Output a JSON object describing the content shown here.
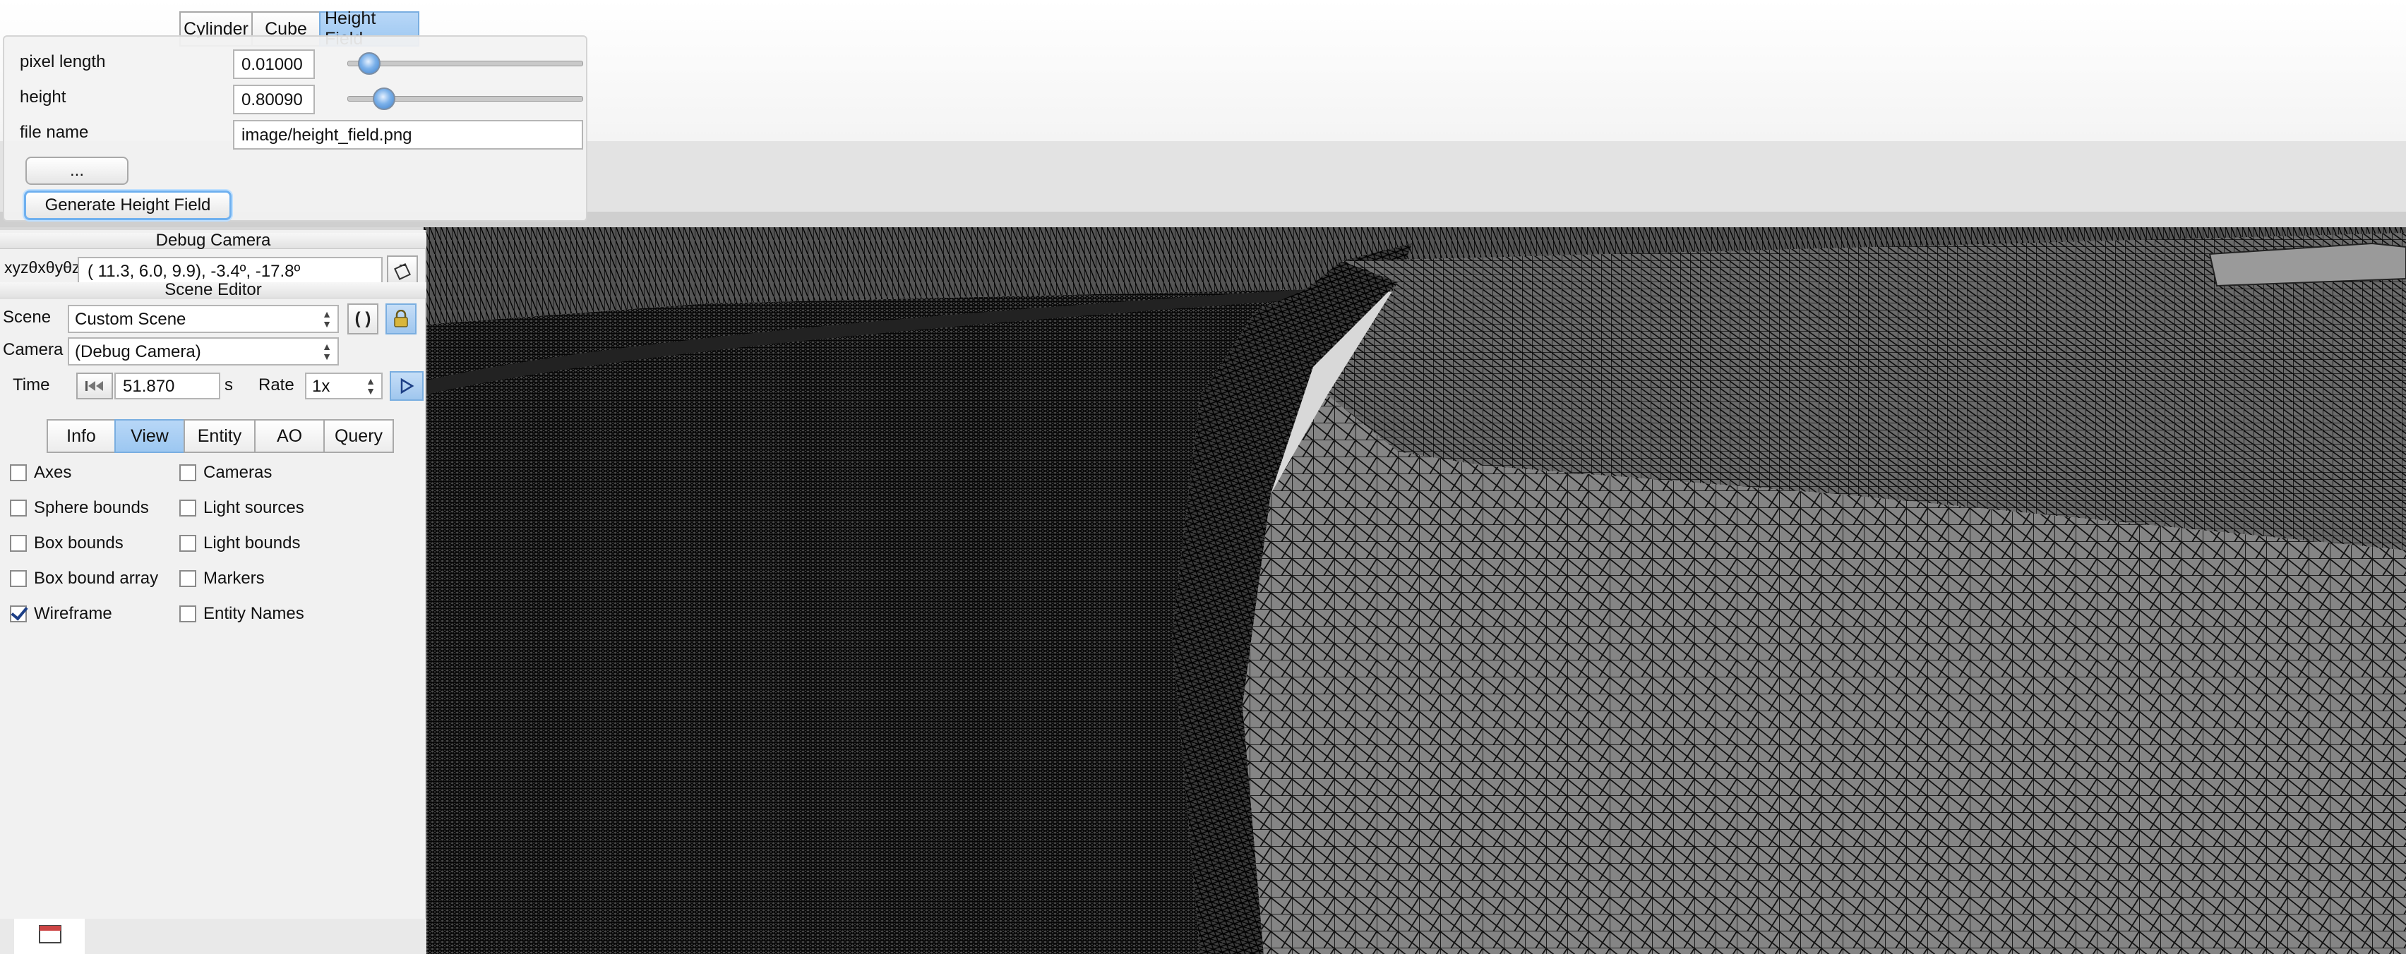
{
  "height_field_panel": {
    "tabs": [
      {
        "label": "Cylinder",
        "selected": false
      },
      {
        "label": "Cube",
        "selected": false
      },
      {
        "label": "Height Field",
        "selected": true
      }
    ],
    "pixel_length": {
      "label": "pixel length",
      "value": "0.01000",
      "slider_fraction": 0.05
    },
    "height": {
      "label": "height",
      "value": "0.80090",
      "slider_fraction": 0.12
    },
    "file_name": {
      "label": "file name",
      "value": "image/height_field.png"
    },
    "browse_label": "...",
    "generate_label": "Generate Height Field"
  },
  "debug_camera": {
    "title": "Debug Camera",
    "coord_label": "xyzθxθyθz",
    "coord_value": "( 11.3,   6.0,   9.9),  -3.4º, -17.8º",
    "copy_icon": "clipboard-icon"
  },
  "scene_editor": {
    "title": "Scene Editor",
    "scene_label": "Scene",
    "scene_value": "Custom Scene",
    "camera_label": "Camera",
    "camera_value": "(Debug Camera)",
    "time_label": "Time",
    "time_value": "51.870",
    "time_unit": "s",
    "rate_label": "Rate",
    "rate_value": "1x",
    "tabs": [
      {
        "label": "Info",
        "selected": false
      },
      {
        "label": "View",
        "selected": true
      },
      {
        "label": "Entity",
        "selected": false
      },
      {
        "label": "AO",
        "selected": false
      },
      {
        "label": "Query",
        "selected": false
      }
    ],
    "checkboxes_left": [
      {
        "label": "Axes",
        "checked": false
      },
      {
        "label": "Sphere bounds",
        "checked": false
      },
      {
        "label": "Box bounds",
        "checked": false
      },
      {
        "label": "Box bound array",
        "checked": false
      },
      {
        "label": "Wireframe",
        "checked": true
      }
    ],
    "checkboxes_right": [
      {
        "label": "Cameras",
        "checked": false
      },
      {
        "label": "Light sources",
        "checked": false
      },
      {
        "label": "Light bounds",
        "checked": false
      },
      {
        "label": "Markers",
        "checked": false
      },
      {
        "label": "Entity Names",
        "checked": false
      }
    ]
  },
  "colors": {
    "accent": "#9cc7f1",
    "mesh_fill": "#7a7a7a",
    "mesh_line": "#101010"
  }
}
